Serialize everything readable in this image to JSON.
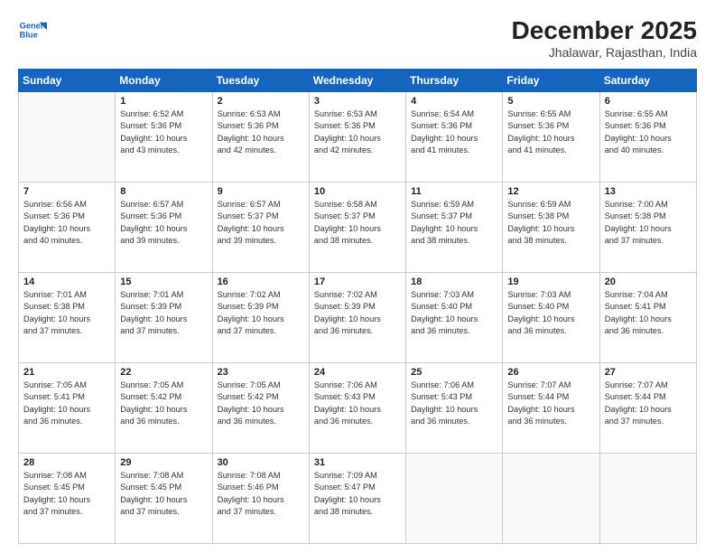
{
  "logo": {
    "line1": "General",
    "line2": "Blue"
  },
  "title": "December 2025",
  "subtitle": "Jhalawar, Rajasthan, India",
  "days_header": [
    "Sunday",
    "Monday",
    "Tuesday",
    "Wednesday",
    "Thursday",
    "Friday",
    "Saturday"
  ],
  "weeks": [
    [
      {
        "day": "",
        "info": ""
      },
      {
        "day": "1",
        "info": "Sunrise: 6:52 AM\nSunset: 5:36 PM\nDaylight: 10 hours\nand 43 minutes."
      },
      {
        "day": "2",
        "info": "Sunrise: 6:53 AM\nSunset: 5:36 PM\nDaylight: 10 hours\nand 42 minutes."
      },
      {
        "day": "3",
        "info": "Sunrise: 6:53 AM\nSunset: 5:36 PM\nDaylight: 10 hours\nand 42 minutes."
      },
      {
        "day": "4",
        "info": "Sunrise: 6:54 AM\nSunset: 5:36 PM\nDaylight: 10 hours\nand 41 minutes."
      },
      {
        "day": "5",
        "info": "Sunrise: 6:55 AM\nSunset: 5:36 PM\nDaylight: 10 hours\nand 41 minutes."
      },
      {
        "day": "6",
        "info": "Sunrise: 6:55 AM\nSunset: 5:36 PM\nDaylight: 10 hours\nand 40 minutes."
      }
    ],
    [
      {
        "day": "7",
        "info": "Sunrise: 6:56 AM\nSunset: 5:36 PM\nDaylight: 10 hours\nand 40 minutes."
      },
      {
        "day": "8",
        "info": "Sunrise: 6:57 AM\nSunset: 5:36 PM\nDaylight: 10 hours\nand 39 minutes."
      },
      {
        "day": "9",
        "info": "Sunrise: 6:57 AM\nSunset: 5:37 PM\nDaylight: 10 hours\nand 39 minutes."
      },
      {
        "day": "10",
        "info": "Sunrise: 6:58 AM\nSunset: 5:37 PM\nDaylight: 10 hours\nand 38 minutes."
      },
      {
        "day": "11",
        "info": "Sunrise: 6:59 AM\nSunset: 5:37 PM\nDaylight: 10 hours\nand 38 minutes."
      },
      {
        "day": "12",
        "info": "Sunrise: 6:59 AM\nSunset: 5:38 PM\nDaylight: 10 hours\nand 38 minutes."
      },
      {
        "day": "13",
        "info": "Sunrise: 7:00 AM\nSunset: 5:38 PM\nDaylight: 10 hours\nand 37 minutes."
      }
    ],
    [
      {
        "day": "14",
        "info": "Sunrise: 7:01 AM\nSunset: 5:38 PM\nDaylight: 10 hours\nand 37 minutes."
      },
      {
        "day": "15",
        "info": "Sunrise: 7:01 AM\nSunset: 5:39 PM\nDaylight: 10 hours\nand 37 minutes."
      },
      {
        "day": "16",
        "info": "Sunrise: 7:02 AM\nSunset: 5:39 PM\nDaylight: 10 hours\nand 37 minutes."
      },
      {
        "day": "17",
        "info": "Sunrise: 7:02 AM\nSunset: 5:39 PM\nDaylight: 10 hours\nand 36 minutes."
      },
      {
        "day": "18",
        "info": "Sunrise: 7:03 AM\nSunset: 5:40 PM\nDaylight: 10 hours\nand 36 minutes."
      },
      {
        "day": "19",
        "info": "Sunrise: 7:03 AM\nSunset: 5:40 PM\nDaylight: 10 hours\nand 36 minutes."
      },
      {
        "day": "20",
        "info": "Sunrise: 7:04 AM\nSunset: 5:41 PM\nDaylight: 10 hours\nand 36 minutes."
      }
    ],
    [
      {
        "day": "21",
        "info": "Sunrise: 7:05 AM\nSunset: 5:41 PM\nDaylight: 10 hours\nand 36 minutes."
      },
      {
        "day": "22",
        "info": "Sunrise: 7:05 AM\nSunset: 5:42 PM\nDaylight: 10 hours\nand 36 minutes."
      },
      {
        "day": "23",
        "info": "Sunrise: 7:05 AM\nSunset: 5:42 PM\nDaylight: 10 hours\nand 36 minutes."
      },
      {
        "day": "24",
        "info": "Sunrise: 7:06 AM\nSunset: 5:43 PM\nDaylight: 10 hours\nand 36 minutes."
      },
      {
        "day": "25",
        "info": "Sunrise: 7:06 AM\nSunset: 5:43 PM\nDaylight: 10 hours\nand 36 minutes."
      },
      {
        "day": "26",
        "info": "Sunrise: 7:07 AM\nSunset: 5:44 PM\nDaylight: 10 hours\nand 36 minutes."
      },
      {
        "day": "27",
        "info": "Sunrise: 7:07 AM\nSunset: 5:44 PM\nDaylight: 10 hours\nand 37 minutes."
      }
    ],
    [
      {
        "day": "28",
        "info": "Sunrise: 7:08 AM\nSunset: 5:45 PM\nDaylight: 10 hours\nand 37 minutes."
      },
      {
        "day": "29",
        "info": "Sunrise: 7:08 AM\nSunset: 5:45 PM\nDaylight: 10 hours\nand 37 minutes."
      },
      {
        "day": "30",
        "info": "Sunrise: 7:08 AM\nSunset: 5:46 PM\nDaylight: 10 hours\nand 37 minutes."
      },
      {
        "day": "31",
        "info": "Sunrise: 7:09 AM\nSunset: 5:47 PM\nDaylight: 10 hours\nand 38 minutes."
      },
      {
        "day": "",
        "info": ""
      },
      {
        "day": "",
        "info": ""
      },
      {
        "day": "",
        "info": ""
      }
    ]
  ]
}
